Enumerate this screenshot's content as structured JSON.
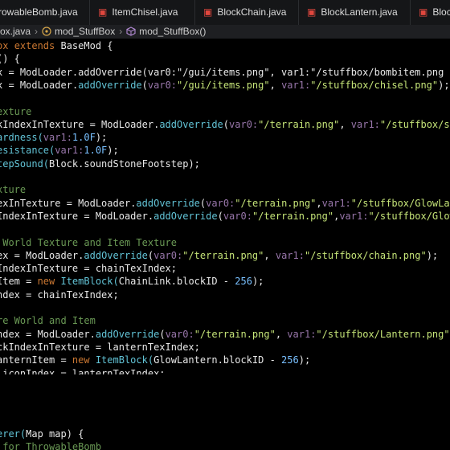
{
  "tabs": [
    {
      "label": "rowableBomb.java"
    },
    {
      "label": "ItemChisel.java"
    },
    {
      "label": "BlockChain.java"
    },
    {
      "label": "BlockLantern.java"
    },
    {
      "label": "Block"
    }
  ],
  "breadcrumb": {
    "file": "ox.java",
    "class": "mod_StuffBox",
    "method": "mod_StuffBox()"
  },
  "code_lines": [
    [
      {
        "t": "ox ",
        "c": "kw"
      },
      {
        "t": "extends ",
        "c": "kw"
      },
      {
        "t": "BaseMod {",
        "c": "ident"
      }
    ],
    [
      {
        "t": "() {",
        "c": "ident"
      }
    ],
    [
      {
        "t": "x = ModLoader.addOverride(var0:\"/gui/items.png\", var1:\"/stuffbox/bombitem.png",
        "c": "ident"
      }
    ],
    [
      {
        "t": "x = ",
        "c": "ident"
      },
      {
        "t": "ModLoader",
        "c": "ident"
      },
      {
        "t": ".",
        "c": "ident"
      },
      {
        "t": "addOverride",
        "c": "fn"
      },
      {
        "t": "(",
        "c": "ident"
      },
      {
        "t": "var0:",
        "c": "param"
      },
      {
        "t": "\"/gui/items.png\"",
        "c": "str"
      },
      {
        "t": ", ",
        "c": "ident"
      },
      {
        "t": "var1:",
        "c": "param"
      },
      {
        "t": "\"/stuffbox/chisel.png\"",
        "c": "str"
      },
      {
        "t": ");",
        "c": "ident"
      }
    ],
    [],
    [
      {
        "t": "exture",
        "c": "cmt"
      }
    ],
    [
      {
        "t": "kIndexInTexture = ",
        "c": "ident"
      },
      {
        "t": "ModLoader",
        "c": "ident"
      },
      {
        "t": ".",
        "c": "ident"
      },
      {
        "t": "addOverride",
        "c": "fn"
      },
      {
        "t": "(",
        "c": "ident"
      },
      {
        "t": "var0:",
        "c": "param"
      },
      {
        "t": "\"/terrain.png\"",
        "c": "str"
      },
      {
        "t": ", ",
        "c": "ident"
      },
      {
        "t": "var1:",
        "c": "param"
      },
      {
        "t": "\"/stuffbox/stonebri",
        "c": "str"
      }
    ],
    [
      {
        "t": "ardness(",
        "c": "fn"
      },
      {
        "t": "var1:",
        "c": "param"
      },
      {
        "t": "1.0F",
        "c": "num"
      },
      {
        "t": ");",
        "c": "ident"
      }
    ],
    [
      {
        "t": "esistance(",
        "c": "fn"
      },
      {
        "t": "var1:",
        "c": "param"
      },
      {
        "t": "1.0F",
        "c": "num"
      },
      {
        "t": ");",
        "c": "ident"
      }
    ],
    [
      {
        "t": "tepSound(",
        "c": "fn"
      },
      {
        "t": "Block",
        "c": "ident"
      },
      {
        "t": ".soundStoneFootstep",
        "c": "ident"
      },
      {
        "t": ");",
        "c": "ident"
      }
    ],
    [],
    [
      {
        "t": "xture",
        "c": "cmt"
      }
    ],
    [
      {
        "t": "exInTexture = ",
        "c": "ident"
      },
      {
        "t": "ModLoader",
        "c": "ident"
      },
      {
        "t": ".",
        "c": "ident"
      },
      {
        "t": "addOverride",
        "c": "fn"
      },
      {
        "t": "(",
        "c": "ident"
      },
      {
        "t": "var0:",
        "c": "param"
      },
      {
        "t": "\"/terrain.png\"",
        "c": "str"
      },
      {
        "t": ",",
        "c": "ident"
      },
      {
        "t": "var1:",
        "c": "param"
      },
      {
        "t": "\"/stuffbox/GlowLampOn.p",
        "c": "str"
      }
    ],
    [
      {
        "t": "IndexInTexture = ",
        "c": "ident"
      },
      {
        "t": "ModLoader",
        "c": "ident"
      },
      {
        "t": ".",
        "c": "ident"
      },
      {
        "t": "addOverride",
        "c": "fn"
      },
      {
        "t": "(",
        "c": "ident"
      },
      {
        "t": "var0:",
        "c": "param"
      },
      {
        "t": "\"/terrain.png\"",
        "c": "str"
      },
      {
        "t": ",",
        "c": "ident"
      },
      {
        "t": "var1:",
        "c": "param"
      },
      {
        "t": "\"/stuffbox/GlowLampOf",
        "c": "str"
      }
    ],
    [],
    [
      {
        "t": " World Texture and Item Texture",
        "c": "cmt"
      }
    ],
    [
      {
        "t": "ex = ",
        "c": "ident"
      },
      {
        "t": "ModLoader",
        "c": "ident"
      },
      {
        "t": ".",
        "c": "ident"
      },
      {
        "t": "addOverride",
        "c": "fn"
      },
      {
        "t": "(",
        "c": "ident"
      },
      {
        "t": "var0:",
        "c": "param"
      },
      {
        "t": "\"/terrain.png\"",
        "c": "str"
      },
      {
        "t": ", ",
        "c": "ident"
      },
      {
        "t": "var1:",
        "c": "param"
      },
      {
        "t": "\"/stuffbox/chain.png\"",
        "c": "str"
      },
      {
        "t": ");",
        "c": "ident"
      }
    ],
    [
      {
        "t": "IndexInTexture = chainTexIndex;",
        "c": "ident"
      }
    ],
    [
      {
        "t": "Item = ",
        "c": "ident"
      },
      {
        "t": "new ",
        "c": "kw"
      },
      {
        "t": "ItemBlock(",
        "c": "fn"
      },
      {
        "t": "ChainLink",
        "c": "ident"
      },
      {
        "t": ".blockID - ",
        "c": "ident"
      },
      {
        "t": "256",
        "c": "num"
      },
      {
        "t": ");",
        "c": "ident"
      }
    ],
    [
      {
        "t": "ndex = chainTexIndex;",
        "c": "ident"
      }
    ],
    [],
    [
      {
        "t": "re World and Item",
        "c": "cmt"
      }
    ],
    [
      {
        "t": "ndex = ",
        "c": "ident"
      },
      {
        "t": "ModLoader",
        "c": "ident"
      },
      {
        "t": ".",
        "c": "ident"
      },
      {
        "t": "addOverride",
        "c": "fn"
      },
      {
        "t": "(",
        "c": "ident"
      },
      {
        "t": "var0:",
        "c": "param"
      },
      {
        "t": "\"/terrain.png\"",
        "c": "str"
      },
      {
        "t": ", ",
        "c": "ident"
      },
      {
        "t": "var1:",
        "c": "param"
      },
      {
        "t": "\"/stuffbox/Lantern.png\"",
        "c": "str"
      },
      {
        "t": ");",
        "c": "ident"
      }
    ],
    [
      {
        "t": "ckIndexInTexture = lanternTexIndex;",
        "c": "ident"
      }
    ],
    [
      {
        "t": "anternItem = ",
        "c": "ident"
      },
      {
        "t": "new ",
        "c": "kw"
      },
      {
        "t": "ItemBlock(",
        "c": "fn"
      },
      {
        "t": "GlowLantern",
        "c": "ident"
      },
      {
        "t": ".blockID - ",
        "c": "ident"
      },
      {
        "t": "256",
        "c": "num"
      },
      {
        "t": ");",
        "c": "ident"
      }
    ],
    [
      {
        "t": ".iconIndex = lanternTexIndex;",
        "c": "ident"
      }
    ]
  ],
  "lower_lines": [
    [
      {
        "t": "erer(",
        "c": "fn"
      },
      {
        "t": "Map ",
        "c": "ident"
      },
      {
        "t": "map) {",
        "c": "ident"
      }
    ],
    [
      {
        "t": " for ThrowableBomb",
        "c": "cmt"
      }
    ]
  ],
  "colors": {
    "tab_icon": "#e0473e",
    "divider": "#d8705a"
  }
}
